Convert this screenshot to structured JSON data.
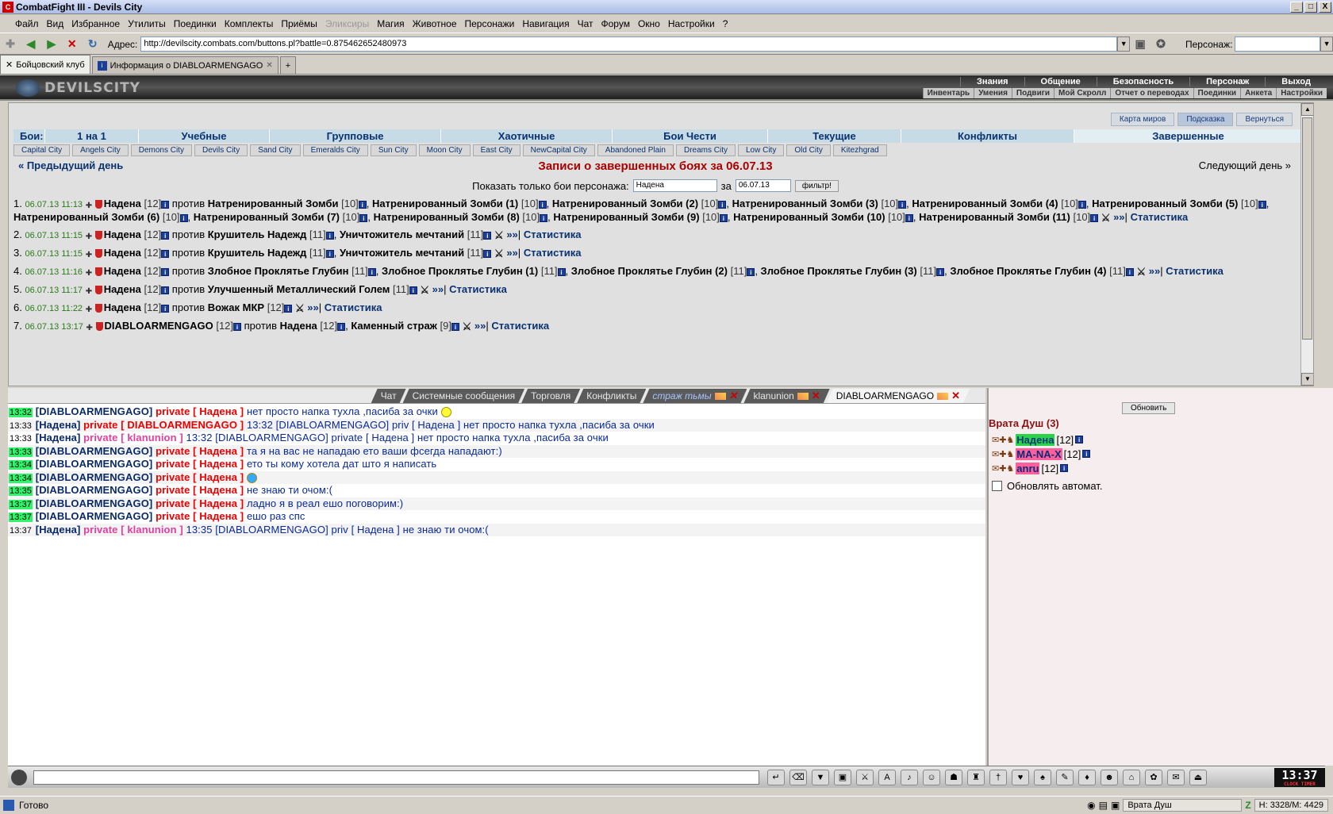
{
  "window": {
    "title": "CombatFight III - Devils City",
    "min": "_",
    "max": "□",
    "close": "X"
  },
  "menu": [
    "Файл",
    "Вид",
    "Избранное",
    "Утилиты",
    "Поединки",
    "Комплекты",
    "Приёмы",
    "Эликсиры",
    "Магия",
    "Животное",
    "Персонажи",
    "Навигация",
    "Чат",
    "Форум",
    "Окно",
    "Настройки",
    "?"
  ],
  "address": {
    "label": "Адрес:",
    "url": "http://devilscity.combats.com/buttons.pl?battle=0.875462652480973",
    "char_label": "Персонаж:"
  },
  "tabs": [
    {
      "label": "Бойцовский клуб"
    },
    {
      "label": "Информация о DIABLOARMENGAGO"
    }
  ],
  "header": {
    "logo": "DEVILSCITY",
    "nav": [
      "Знания",
      "Общение",
      "Безопасность",
      "Персонаж",
      "Выход"
    ],
    "subnav": [
      "Инвентарь",
      "Умения",
      "Подвиги",
      "Мой Скролл",
      "Отчет о переводах",
      "Поединки",
      "Анкета",
      "Настройки"
    ]
  },
  "topbuttons": [
    "Карта миров",
    "Подсказка",
    "Вернуться"
  ],
  "fights": {
    "label": "Бои:",
    "items": [
      "1 на 1",
      "Учебные",
      "Групповые",
      "Хаотичные",
      "Бои Чести",
      "Текущие",
      "Конфликты",
      "Завершенные"
    ]
  },
  "cities": [
    "Capital City",
    "Angels City",
    "Demons City",
    "Devils City",
    "Sand City",
    "Emeralds City",
    "Sun City",
    "Moon City",
    "East City",
    "NewCapital City",
    "Abandoned Plain",
    "Dreams City",
    "Low City",
    "Old City",
    "Kitezhgrad"
  ],
  "prev_day": "« Предыдущий день",
  "next_day": "Следующий день »",
  "page_title": "Записи о завершенных боях за 06.07.13",
  "filter": {
    "label": "Показать только бои персонажа:",
    "name": "Надена",
    "za": "за",
    "date": "06.07.13",
    "button": "фильтр!"
  },
  "logs": [
    {
      "n": "1.",
      "dt": "06.07.13 11:13",
      "text": "Надена [12] против Натренированный Зомби [10], Натренированный Зомби (1) [10], Натренированный Зомби (2) [10], Натренированный Зомби (3) [10], Натренированный Зомби (4) [10], Натренированный Зомби (5) [10], Натренированный Зомби (6) [10], Натренированный Зомби (7) [10], Натренированный Зомби (8) [10], Натренированный Зомби (9) [10], Натренированный Зомби (10) [10], Натренированный Зомби (11) [10]"
    },
    {
      "n": "2.",
      "dt": "06.07.13 11:15",
      "text": "Надена [12] против Крушитель Надежд [11], Уничтожитель мечтаний [11]"
    },
    {
      "n": "3.",
      "dt": "06.07.13 11:15",
      "text": "Надена [12] против Крушитель Надежд [11], Уничтожитель мечтаний [11]"
    },
    {
      "n": "4.",
      "dt": "06.07.13 11:16",
      "text": "Надена [12] против Злобное Проклятье Глубин [11], Злобное Проклятье Глубин (1) [11], Злобное Проклятье Глубин (2) [11], Злобное Проклятье Глубин (3) [11], Злобное Проклятье Глубин (4) [11]"
    },
    {
      "n": "5.",
      "dt": "06.07.13 11:17",
      "text": "Надена [12] против Улучшенный Металлический Голем [11]"
    },
    {
      "n": "6.",
      "dt": "06.07.13 11:22",
      "text": "Надена [12] против Вожак МКР [12]"
    },
    {
      "n": "7.",
      "dt": "06.07.13 13:17",
      "text": "DIABLOARMENGAGO [12] против Надена [12], Каменный страж [9]"
    }
  ],
  "log_arrows": "»»",
  "log_stat": "Статистика",
  "chat_tabs": [
    "Чат",
    "Системные сообщения",
    "Торговля",
    "Конфликты",
    "страж тьмы",
    "klanunion",
    "DIABLOARMENGAGO"
  ],
  "chat": [
    {
      "t": "13:32",
      "g": true,
      "who": "DIABLOARMENGAGO",
      "ptype": "private",
      "to": "Надена",
      "msg": "нет просто напка тухла ,пасиба за очки"
    },
    {
      "t": "13:33",
      "g": false,
      "who": "Надена",
      "ptype": "private",
      "to": "DIABLOARMENGAGO",
      "msg": "13:32 [DIABLOARMENGAGO] priv [ Надена ] нет просто напка тухла ,пасиба за очки"
    },
    {
      "t": "13:33",
      "g": false,
      "who": "Надена",
      "ptype": "private",
      "to": "klanunion",
      "msg": "13:32 [DIABLOARMENGAGO] private [ Надена ] нет просто напка тухла ,пасиба за очки"
    },
    {
      "t": "13:33",
      "g": true,
      "who": "DIABLOARMENGAGO",
      "ptype": "private",
      "to": "Надена",
      "msg": "та я на вас не нападаю ето ваши фсегда нападают:)"
    },
    {
      "t": "13:34",
      "g": true,
      "who": "DIABLOARMENGAGO",
      "ptype": "private",
      "to": "Надена",
      "msg": "ето ты кому хотела дат што я написать"
    },
    {
      "t": "13:34",
      "g": true,
      "who": "DIABLOARMENGAGO",
      "ptype": "private",
      "to": "Надена",
      "msg": ""
    },
    {
      "t": "13:35",
      "g": true,
      "who": "DIABLOARMENGAGO",
      "ptype": "private",
      "to": "Надена",
      "msg": "не знаю ти очом:("
    },
    {
      "t": "13:37",
      "g": true,
      "who": "DIABLOARMENGAGO",
      "ptype": "private",
      "to": "Надена",
      "msg": "ладно я в реал ешо поговорим:)"
    },
    {
      "t": "13:37",
      "g": true,
      "who": "DIABLOARMENGAGO",
      "ptype": "private",
      "to": "Надена",
      "msg": "ешо раз спс"
    },
    {
      "t": "13:37",
      "g": false,
      "who": "Надена",
      "ptype": "private",
      "to": "klanunion",
      "msg": "13:35 [DIABLOARMENGAGO] priv [ Надена ] не знаю ти очом:("
    }
  ],
  "right": {
    "refresh": "Обновить",
    "location": "Врата Душ (3)",
    "users": [
      {
        "name": "Надена",
        "lvl": "[12]",
        "color": "g"
      },
      {
        "name": "MA-NA-X",
        "lvl": "[12]",
        "color": "p"
      },
      {
        "name": "anru",
        "lvl": "[12]",
        "color": "p"
      }
    ],
    "auto": "Обновлять автомат."
  },
  "clock": {
    "time": "13:37",
    "label": "CLOCK TIMER"
  },
  "status": {
    "ready": "Готово",
    "loc": "Врата Душ",
    "hp": "H: 3328/M: 4429"
  }
}
